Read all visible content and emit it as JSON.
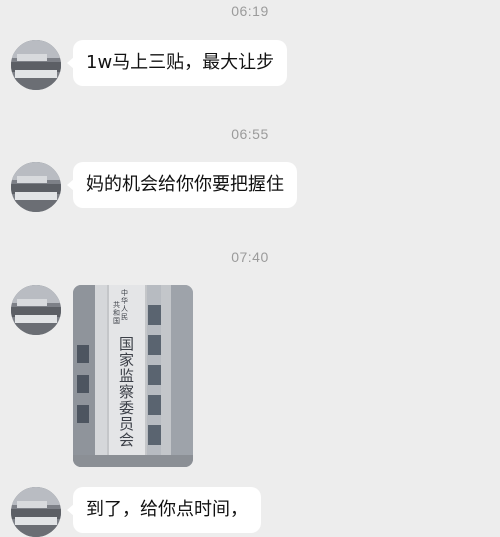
{
  "messages": [
    {
      "time": "06:19",
      "text": "1w马上三贴，最大让步"
    },
    {
      "time": "06:55",
      "text": "妈的机会给你你要把握住"
    },
    {
      "time": "07:40",
      "image": {
        "sign_small_left": "中华人民共和国",
        "sign_main": "国家监察委员会"
      }
    },
    {
      "text": "到了，给你点时间，"
    }
  ]
}
